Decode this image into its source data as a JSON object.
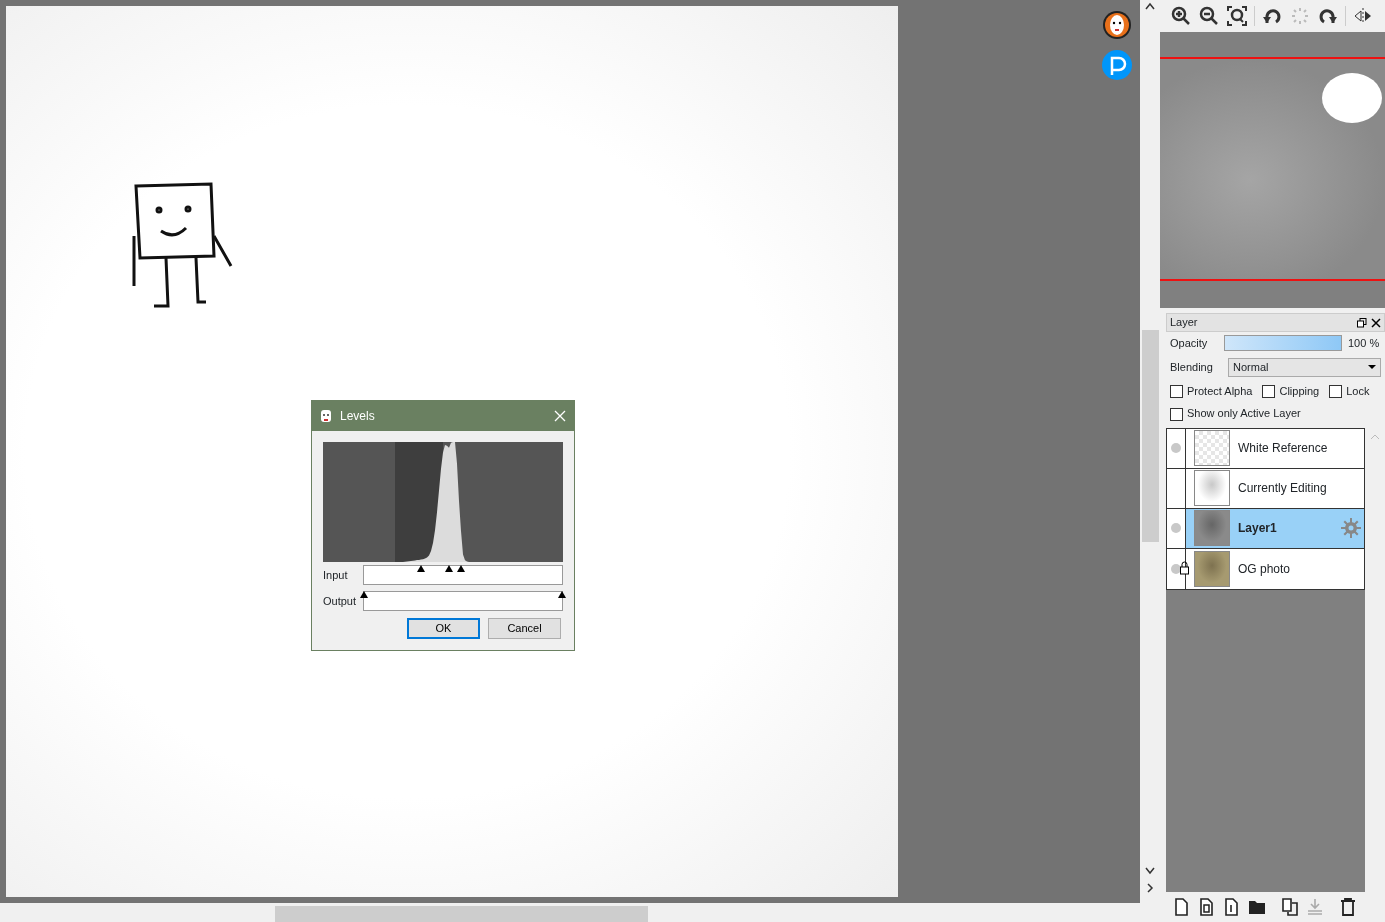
{
  "levels_dialog": {
    "title": "Levels",
    "input_label": "Input",
    "input_handles": [
      {
        "level": 0.29
      },
      {
        "level": 0.43
      },
      {
        "level": 0.49
      }
    ],
    "output_label": "Output",
    "output_handles": [
      {
        "level": 0
      },
      {
        "level": 1
      }
    ],
    "buttons": [
      {
        "label": "OK",
        "default": true
      },
      {
        "label": "Cancel",
        "default": false
      }
    ]
  },
  "layer_panel": {
    "title": "Layer",
    "opacity": {
      "label": "Opacity",
      "level": 1,
      "reading": "100 %"
    },
    "blending": {
      "label": "Blending",
      "value": "Normal"
    },
    "options": [
      {
        "label": "Protect Alpha",
        "checked": false
      },
      {
        "label": "Clipping",
        "checked": false
      },
      {
        "label": "Lock",
        "checked": false
      },
      {
        "label": "Show only Active Layer",
        "checked": false
      }
    ],
    "layers": [
      {
        "name": "White Reference",
        "visible": true,
        "locked": false,
        "selected": false,
        "kind": "transparent"
      },
      {
        "name": "Currently Editing",
        "visible": false,
        "locked": false,
        "selected": false,
        "kind": "sketch"
      },
      {
        "name": "Layer1",
        "visible": true,
        "locked": false,
        "selected": true,
        "kind": "gray"
      },
      {
        "name": "OG photo",
        "visible": true,
        "locked": true,
        "selected": false,
        "kind": "photo"
      }
    ]
  }
}
